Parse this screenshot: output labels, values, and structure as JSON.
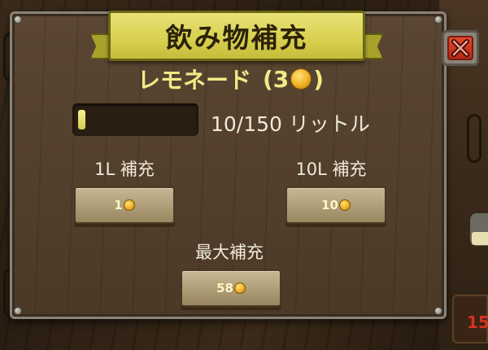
{
  "title": "飲み物補充",
  "item": {
    "name": "レモネード",
    "price_prefix": "(3",
    "price_suffix": ")",
    "price_icon": "gold-coin-icon"
  },
  "capacity": {
    "current": 10,
    "max": 150,
    "fill_fraction": 0.067,
    "text": "10/150 リットル"
  },
  "refill_options": [
    {
      "label": "1L 補充",
      "cost": "1",
      "icon": "gold-coin-icon"
    },
    {
      "label": "10L 補充",
      "cost": "10",
      "icon": "gold-coin-icon"
    },
    {
      "label": "最大補充",
      "cost": "58",
      "icon": "gold-coin-icon"
    }
  ],
  "close_icon": "close-icon",
  "colors": {
    "banner": "#d9d150",
    "panel": "#523f2c",
    "item_title": "#f1ea86",
    "close": "#c9341c",
    "coin": "#f0b020",
    "button": "#b3a37e"
  },
  "background": {
    "chip_text": "15"
  }
}
